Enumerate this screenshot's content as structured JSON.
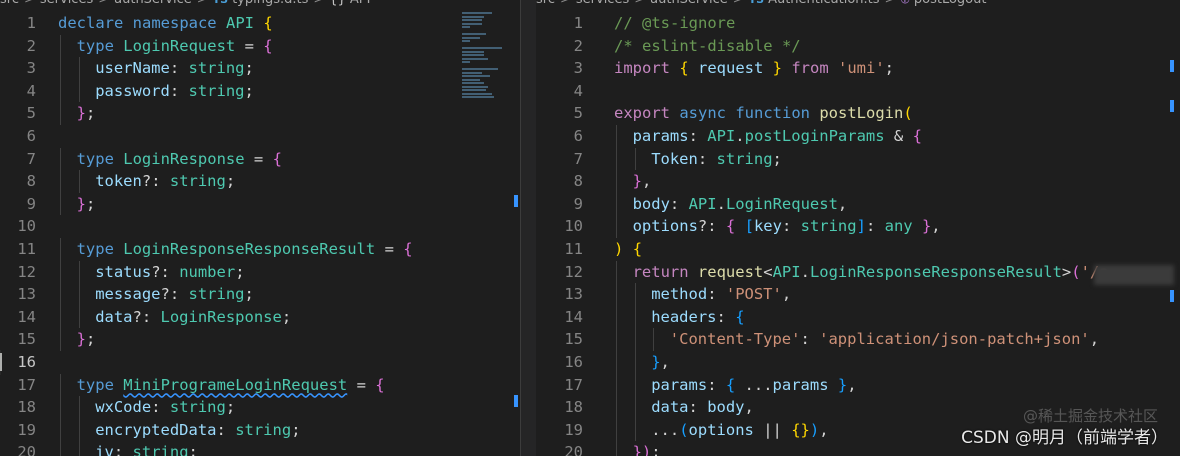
{
  "left": {
    "breadcrumb": {
      "path": [
        "src",
        "services",
        "authService"
      ],
      "file": "typings.d.ts",
      "file_lang": "TS",
      "symbol_icon": "{}",
      "symbol": "API"
    },
    "lines": [
      {
        "n": "1",
        "tokens": [
          [
            "k",
            "declare "
          ],
          [
            "k",
            "namespace "
          ],
          [
            "t",
            "API "
          ],
          [
            "b1",
            "{"
          ]
        ]
      },
      {
        "n": "2",
        "indent": 1,
        "tokens": [
          [
            "k",
            "type "
          ],
          [
            "t",
            "LoginRequest"
          ],
          [
            "o",
            " = "
          ],
          [
            "b2",
            "{"
          ]
        ]
      },
      {
        "n": "3",
        "indent": 2,
        "tokens": [
          [
            "p",
            "userName"
          ],
          [
            "o",
            ": "
          ],
          [
            "t",
            "string"
          ],
          [
            "o",
            ";"
          ]
        ]
      },
      {
        "n": "4",
        "indent": 2,
        "tokens": [
          [
            "p",
            "password"
          ],
          [
            "o",
            ": "
          ],
          [
            "t",
            "string"
          ],
          [
            "o",
            ";"
          ]
        ]
      },
      {
        "n": "5",
        "indent": 1,
        "tokens": [
          [
            "b2",
            "}"
          ],
          [
            "o",
            ";"
          ]
        ]
      },
      {
        "n": "6",
        "tokens": []
      },
      {
        "n": "7",
        "indent": 1,
        "tokens": [
          [
            "k",
            "type "
          ],
          [
            "t",
            "LoginResponse"
          ],
          [
            "o",
            " = "
          ],
          [
            "b2",
            "{"
          ]
        ]
      },
      {
        "n": "8",
        "indent": 2,
        "tokens": [
          [
            "p",
            "token"
          ],
          [
            "o",
            "?: "
          ],
          [
            "t",
            "string"
          ],
          [
            "o",
            ";"
          ]
        ]
      },
      {
        "n": "9",
        "indent": 1,
        "tokens": [
          [
            "b2",
            "}"
          ],
          [
            "o",
            ";"
          ]
        ]
      },
      {
        "n": "10",
        "tokens": []
      },
      {
        "n": "11",
        "indent": 1,
        "tokens": [
          [
            "k",
            "type "
          ],
          [
            "t",
            "LoginResponseResponseResult"
          ],
          [
            "o",
            " = "
          ],
          [
            "b2",
            "{"
          ]
        ]
      },
      {
        "n": "12",
        "indent": 2,
        "tokens": [
          [
            "p",
            "status"
          ],
          [
            "o",
            "?: "
          ],
          [
            "t",
            "number"
          ],
          [
            "o",
            ";"
          ]
        ]
      },
      {
        "n": "13",
        "indent": 2,
        "tokens": [
          [
            "p",
            "message"
          ],
          [
            "o",
            "?: "
          ],
          [
            "t",
            "string"
          ],
          [
            "o",
            ";"
          ]
        ]
      },
      {
        "n": "14",
        "indent": 2,
        "tokens": [
          [
            "p",
            "data"
          ],
          [
            "o",
            "?: "
          ],
          [
            "t",
            "LoginResponse"
          ],
          [
            "o",
            ";"
          ]
        ]
      },
      {
        "n": "15",
        "indent": 1,
        "tokens": [
          [
            "b2",
            "}"
          ],
          [
            "o",
            ";"
          ]
        ]
      },
      {
        "n": "16",
        "tokens": [],
        "current": true
      },
      {
        "n": "17",
        "indent": 1,
        "tokens": [
          [
            "k",
            "type "
          ],
          [
            "t squig",
            "MiniProgrameLoginRequest"
          ],
          [
            "o",
            " = "
          ],
          [
            "b2",
            "{"
          ]
        ]
      },
      {
        "n": "18",
        "indent": 2,
        "tokens": [
          [
            "p",
            "wxCode"
          ],
          [
            "o",
            ": "
          ],
          [
            "t",
            "string"
          ],
          [
            "o",
            ";"
          ]
        ]
      },
      {
        "n": "19",
        "indent": 2,
        "tokens": [
          [
            "p",
            "encryptedData"
          ],
          [
            "o",
            ": "
          ],
          [
            "t",
            "string"
          ],
          [
            "o",
            ";"
          ]
        ]
      },
      {
        "n": "20",
        "indent": 2,
        "tokens": [
          [
            "p",
            "iv"
          ],
          [
            "o",
            ": "
          ],
          [
            "t",
            "string"
          ],
          [
            "o",
            ";"
          ]
        ]
      }
    ]
  },
  "right": {
    "breadcrumb": {
      "path": [
        "src",
        "services",
        "authService"
      ],
      "file": "Authentication.ts",
      "file_lang": "TS",
      "symbol": "postLogout"
    },
    "lines": [
      {
        "n": "1",
        "tokens": [
          [
            "cm",
            "// @ts-ignore"
          ]
        ]
      },
      {
        "n": "2",
        "tokens": [
          [
            "cm",
            "/* eslint-disable */"
          ]
        ]
      },
      {
        "n": "3",
        "tokens": [
          [
            "c",
            "import "
          ],
          [
            "b1",
            "{ "
          ],
          [
            "p",
            "request"
          ],
          [
            "b1",
            " }"
          ],
          [
            "c",
            " from "
          ],
          [
            "s",
            "'umi'"
          ],
          [
            "o",
            ";"
          ]
        ]
      },
      {
        "n": "4",
        "tokens": []
      },
      {
        "n": "5",
        "tokens": [
          [
            "c",
            "export "
          ],
          [
            "k",
            "async "
          ],
          [
            "k",
            "function "
          ],
          [
            "f",
            "postLogin"
          ],
          [
            "b1",
            "("
          ]
        ]
      },
      {
        "n": "6",
        "indent": 1,
        "tokens": [
          [
            "p",
            "params"
          ],
          [
            "o",
            ": "
          ],
          [
            "t",
            "API"
          ],
          [
            "o",
            "."
          ],
          [
            "t",
            "postLoginParams"
          ],
          [
            "o",
            " & "
          ],
          [
            "b2",
            "{"
          ]
        ]
      },
      {
        "n": "7",
        "indent": 2,
        "tokens": [
          [
            "p",
            "Token"
          ],
          [
            "o",
            ": "
          ],
          [
            "t",
            "string"
          ],
          [
            "o",
            ";"
          ]
        ]
      },
      {
        "n": "8",
        "indent": 1,
        "tokens": [
          [
            "b2",
            "}"
          ],
          [
            "o",
            ","
          ]
        ]
      },
      {
        "n": "9",
        "indent": 1,
        "tokens": [
          [
            "p",
            "body"
          ],
          [
            "o",
            ": "
          ],
          [
            "t",
            "API"
          ],
          [
            "o",
            "."
          ],
          [
            "t",
            "LoginRequest"
          ],
          [
            "o",
            ","
          ]
        ]
      },
      {
        "n": "10",
        "indent": 1,
        "tokens": [
          [
            "p",
            "options"
          ],
          [
            "o",
            "?: "
          ],
          [
            "b2",
            "{ "
          ],
          [
            "b3",
            "["
          ],
          [
            "p",
            "key"
          ],
          [
            "o",
            ": "
          ],
          [
            "t",
            "string"
          ],
          [
            "b3",
            "]"
          ],
          [
            "o",
            ": "
          ],
          [
            "t",
            "any"
          ],
          [
            "b2",
            " }"
          ],
          [
            "o",
            ","
          ]
        ]
      },
      {
        "n": "11",
        "tokens": [
          [
            "b1",
            ")"
          ],
          [
            "o",
            " "
          ],
          [
            "b1",
            "{"
          ]
        ]
      },
      {
        "n": "12",
        "indent": 1,
        "tokens": [
          [
            "c",
            "return "
          ],
          [
            "f",
            "request"
          ],
          [
            "o",
            "<"
          ],
          [
            "t",
            "API"
          ],
          [
            "o",
            "."
          ],
          [
            "t",
            "LoginResponseResponseResult"
          ],
          [
            "o",
            ">"
          ],
          [
            "b2",
            "("
          ],
          [
            "s",
            "'/a"
          ]
        ]
      },
      {
        "n": "13",
        "indent": 2,
        "tokens": [
          [
            "p",
            "method"
          ],
          [
            "o",
            ": "
          ],
          [
            "s",
            "'POST'"
          ],
          [
            "o",
            ","
          ]
        ]
      },
      {
        "n": "14",
        "indent": 2,
        "tokens": [
          [
            "p",
            "headers"
          ],
          [
            "o",
            ": "
          ],
          [
            "b3",
            "{"
          ]
        ]
      },
      {
        "n": "15",
        "indent": 3,
        "tokens": [
          [
            "s",
            "'Content-Type'"
          ],
          [
            "o",
            ": "
          ],
          [
            "s",
            "'application/json-patch+json'"
          ],
          [
            "o",
            ","
          ]
        ]
      },
      {
        "n": "16",
        "indent": 2,
        "tokens": [
          [
            "b3",
            "}"
          ],
          [
            "o",
            ","
          ]
        ]
      },
      {
        "n": "17",
        "indent": 2,
        "tokens": [
          [
            "p",
            "params"
          ],
          [
            "o",
            ": "
          ],
          [
            "b3",
            "{ "
          ],
          [
            "o",
            "..."
          ],
          [
            "p",
            "params"
          ],
          [
            "b3",
            " }"
          ],
          [
            "o",
            ","
          ]
        ]
      },
      {
        "n": "18",
        "indent": 2,
        "tokens": [
          [
            "p",
            "data"
          ],
          [
            "o",
            ": "
          ],
          [
            "p",
            "body"
          ],
          [
            "o",
            ","
          ]
        ]
      },
      {
        "n": "19",
        "indent": 2,
        "tokens": [
          [
            "o",
            "..."
          ],
          [
            "b3",
            "("
          ],
          [
            "p",
            "options"
          ],
          [
            "o",
            " || "
          ],
          [
            "b1",
            "{}"
          ],
          [
            "b3",
            ")"
          ],
          [
            "o",
            ","
          ]
        ]
      },
      {
        "n": "20",
        "indent": 1,
        "tokens": [
          [
            "b2",
            "})"
          ],
          [
            "o",
            ";"
          ]
        ]
      }
    ]
  },
  "watermark": {
    "text": "CSDN @明月（前端学者）",
    "ghost": "@稀土掘金技术社区"
  }
}
